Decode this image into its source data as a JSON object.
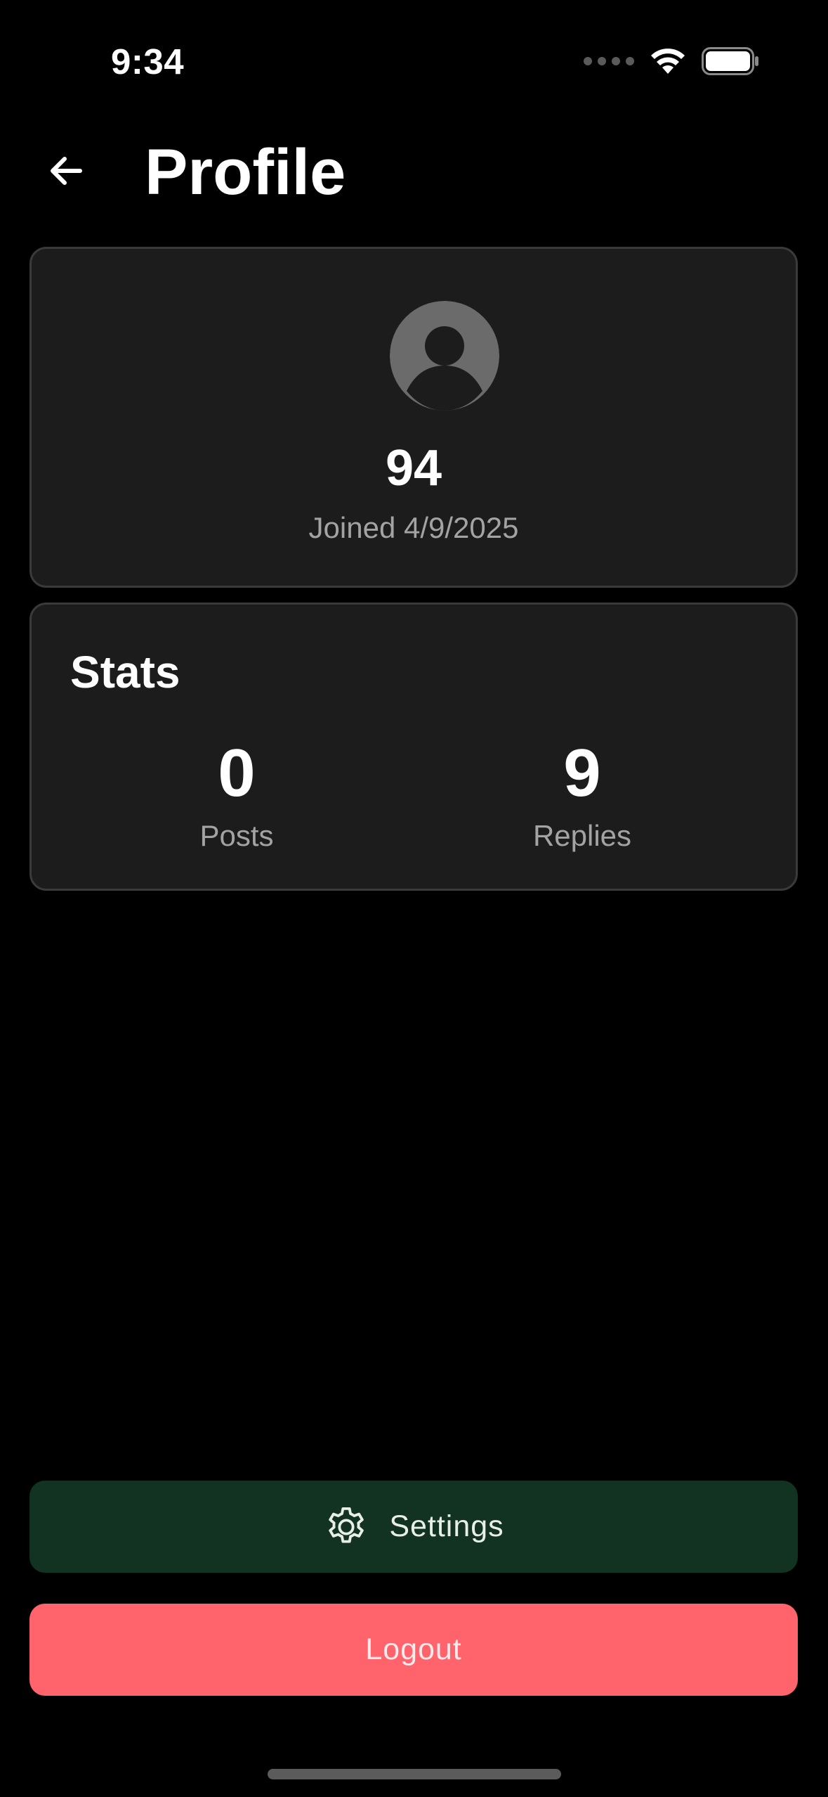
{
  "status_bar": {
    "time": "9:34"
  },
  "header": {
    "title": "Profile"
  },
  "profile": {
    "username": "94",
    "joined_text": "Joined 4/9/2025"
  },
  "stats": {
    "title": "Stats",
    "items": [
      {
        "value": "0",
        "label": "Posts"
      },
      {
        "value": "9",
        "label": "Replies"
      }
    ]
  },
  "actions": {
    "settings_label": "Settings",
    "logout_label": "Logout"
  },
  "colors": {
    "background": "#000000",
    "card": "#1c1c1c",
    "settings_button": "#133322",
    "logout_button": "#ff636c",
    "muted_text": "#a3a3a3"
  },
  "icons": {
    "back": "arrow-left-icon",
    "avatar": "user-placeholder-icon",
    "settings": "gear-icon",
    "wifi": "wifi-icon",
    "battery": "battery-icon",
    "signal": "cellular-signal-icon"
  }
}
